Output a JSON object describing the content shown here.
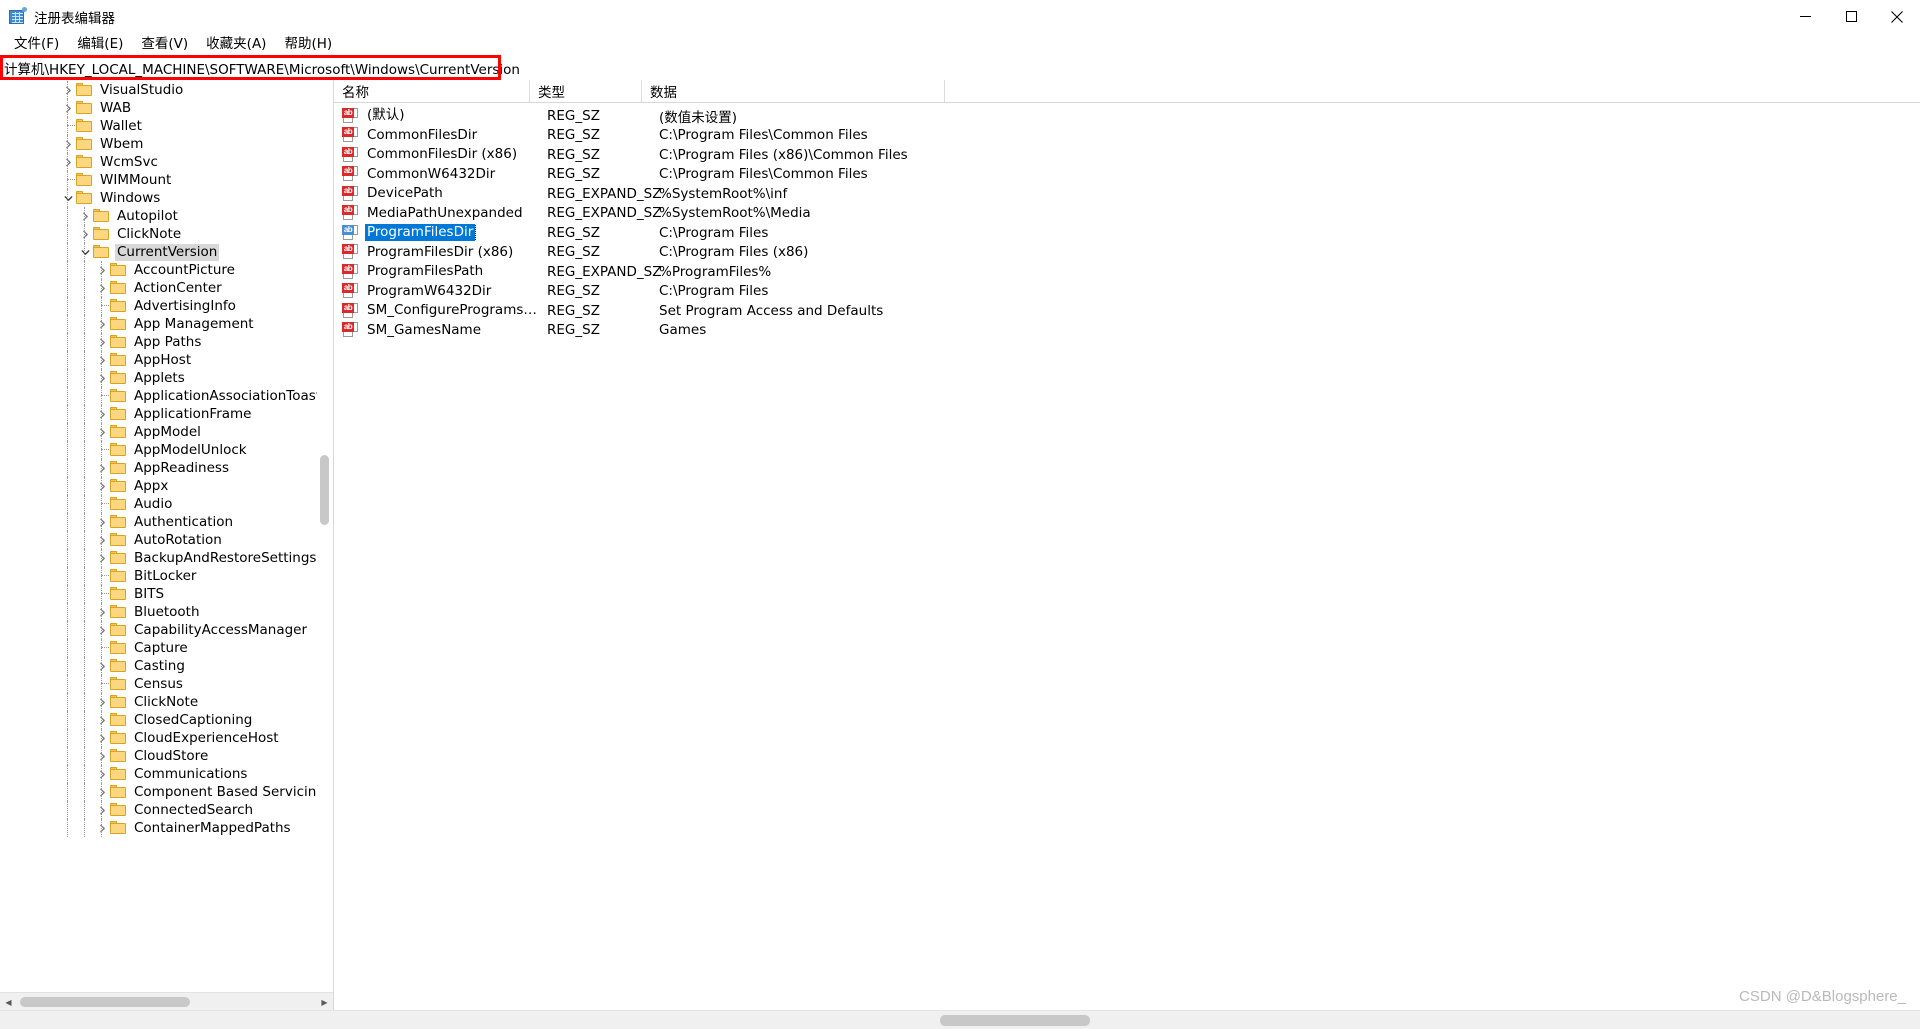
{
  "window": {
    "title": "注册表编辑器",
    "icon": "registry-editor-icon",
    "minimize_label": "最小化",
    "maximize_label": "最大化",
    "close_label": "关闭"
  },
  "menubar": {
    "items": [
      {
        "label": "文件(F)",
        "name": "menu-file"
      },
      {
        "label": "编辑(E)",
        "name": "menu-edit"
      },
      {
        "label": "查看(V)",
        "name": "menu-view"
      },
      {
        "label": "收藏夹(A)",
        "name": "menu-favorites"
      },
      {
        "label": "帮助(H)",
        "name": "menu-help"
      }
    ]
  },
  "address": {
    "value": "计算机\\HKEY_LOCAL_MACHINE\\SOFTWARE\\Microsoft\\Windows\\CurrentVersion",
    "highlight_color": "#ff0000"
  },
  "tree": {
    "selected": "CurrentVersion",
    "items": [
      {
        "label": "VisualStudio",
        "depth": 1,
        "expander": "collapsed"
      },
      {
        "label": "WAB",
        "depth": 1,
        "expander": "collapsed"
      },
      {
        "label": "Wallet",
        "depth": 1,
        "expander": "leaf"
      },
      {
        "label": "Wbem",
        "depth": 1,
        "expander": "collapsed"
      },
      {
        "label": "WcmSvc",
        "depth": 1,
        "expander": "collapsed"
      },
      {
        "label": "WIMMount",
        "depth": 1,
        "expander": "leaf"
      },
      {
        "label": "Windows",
        "depth": 1,
        "expander": "expanded"
      },
      {
        "label": "Autopilot",
        "depth": 2,
        "expander": "collapsed"
      },
      {
        "label": "ClickNote",
        "depth": 2,
        "expander": "collapsed"
      },
      {
        "label": "CurrentVersion",
        "depth": 2,
        "expander": "expanded",
        "selected": true
      },
      {
        "label": "AccountPicture",
        "depth": 3,
        "expander": "collapsed"
      },
      {
        "label": "ActionCenter",
        "depth": 3,
        "expander": "collapsed"
      },
      {
        "label": "AdvertisingInfo",
        "depth": 3,
        "expander": "leaf"
      },
      {
        "label": "App Management",
        "depth": 3,
        "expander": "collapsed"
      },
      {
        "label": "App Paths",
        "depth": 3,
        "expander": "collapsed"
      },
      {
        "label": "AppHost",
        "depth": 3,
        "expander": "collapsed"
      },
      {
        "label": "Applets",
        "depth": 3,
        "expander": "collapsed"
      },
      {
        "label": "ApplicationAssociationToasts",
        "depth": 3,
        "expander": "leaf"
      },
      {
        "label": "ApplicationFrame",
        "depth": 3,
        "expander": "collapsed"
      },
      {
        "label": "AppModel",
        "depth": 3,
        "expander": "collapsed"
      },
      {
        "label": "AppModelUnlock",
        "depth": 3,
        "expander": "leaf"
      },
      {
        "label": "AppReadiness",
        "depth": 3,
        "expander": "collapsed"
      },
      {
        "label": "Appx",
        "depth": 3,
        "expander": "collapsed"
      },
      {
        "label": "Audio",
        "depth": 3,
        "expander": "leaf"
      },
      {
        "label": "Authentication",
        "depth": 3,
        "expander": "collapsed"
      },
      {
        "label": "AutoRotation",
        "depth": 3,
        "expander": "collapsed"
      },
      {
        "label": "BackupAndRestoreSettings",
        "depth": 3,
        "expander": "collapsed"
      },
      {
        "label": "BitLocker",
        "depth": 3,
        "expander": "leaf"
      },
      {
        "label": "BITS",
        "depth": 3,
        "expander": "leaf"
      },
      {
        "label": "Bluetooth",
        "depth": 3,
        "expander": "collapsed"
      },
      {
        "label": "CapabilityAccessManager",
        "depth": 3,
        "expander": "collapsed"
      },
      {
        "label": "Capture",
        "depth": 3,
        "expander": "leaf"
      },
      {
        "label": "Casting",
        "depth": 3,
        "expander": "collapsed"
      },
      {
        "label": "Census",
        "depth": 3,
        "expander": "leaf"
      },
      {
        "label": "ClickNote",
        "depth": 3,
        "expander": "collapsed"
      },
      {
        "label": "ClosedCaptioning",
        "depth": 3,
        "expander": "collapsed"
      },
      {
        "label": "CloudExperienceHost",
        "depth": 3,
        "expander": "collapsed"
      },
      {
        "label": "CloudStore",
        "depth": 3,
        "expander": "collapsed"
      },
      {
        "label": "Communications",
        "depth": 3,
        "expander": "collapsed"
      },
      {
        "label": "Component Based Servicing",
        "depth": 3,
        "expander": "collapsed"
      },
      {
        "label": "ConnectedSearch",
        "depth": 3,
        "expander": "collapsed"
      },
      {
        "label": "ContainerMappedPaths",
        "depth": 3,
        "expander": "collapsed"
      }
    ]
  },
  "values": {
    "columns": [
      {
        "label": "名称",
        "name": "column-name"
      },
      {
        "label": "类型",
        "name": "column-type"
      },
      {
        "label": "数据",
        "name": "column-data"
      }
    ],
    "selected": "ProgramFilesDir",
    "rows": [
      {
        "name": "(默认)",
        "type": "REG_SZ",
        "data": "(数值未设置)"
      },
      {
        "name": "CommonFilesDir",
        "type": "REG_SZ",
        "data": "C:\\Program Files\\Common Files"
      },
      {
        "name": "CommonFilesDir (x86)",
        "type": "REG_SZ",
        "data": "C:\\Program Files (x86)\\Common Files"
      },
      {
        "name": "CommonW6432Dir",
        "type": "REG_SZ",
        "data": "C:\\Program Files\\Common Files"
      },
      {
        "name": "DevicePath",
        "type": "REG_EXPAND_SZ",
        "data": "%SystemRoot%\\inf"
      },
      {
        "name": "MediaPathUnexpanded",
        "type": "REG_EXPAND_SZ",
        "data": "%SystemRoot%\\Media"
      },
      {
        "name": "ProgramFilesDir",
        "type": "REG_SZ",
        "data": "C:\\Program Files",
        "selected": true
      },
      {
        "name": "ProgramFilesDir (x86)",
        "type": "REG_SZ",
        "data": "C:\\Program Files (x86)"
      },
      {
        "name": "ProgramFilesPath",
        "type": "REG_EXPAND_SZ",
        "data": "%ProgramFiles%"
      },
      {
        "name": "ProgramW6432Dir",
        "type": "REG_SZ",
        "data": "C:\\Program Files"
      },
      {
        "name": "SM_ConfigureProgramsNa...",
        "type": "REG_SZ",
        "data": "Set Program Access and Defaults"
      },
      {
        "name": "SM_GamesName",
        "type": "REG_SZ",
        "data": "Games"
      }
    ]
  },
  "watermark": {
    "text": "CSDN @D&Blogsphere_"
  }
}
